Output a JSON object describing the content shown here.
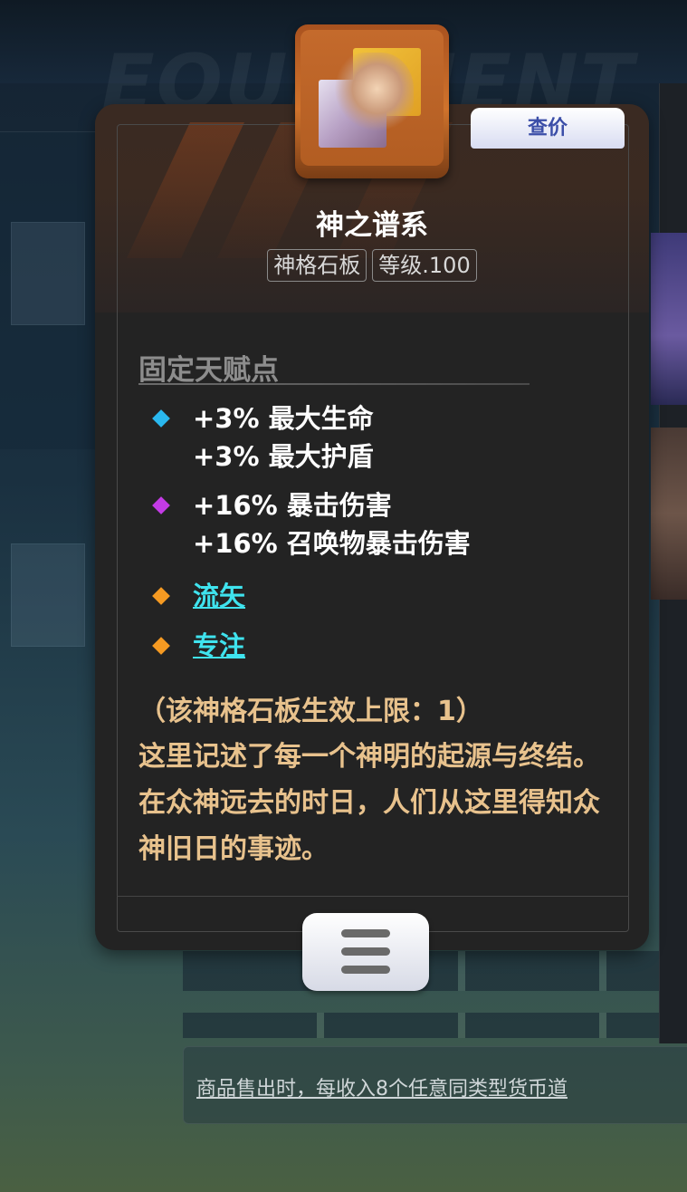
{
  "background": {
    "watermark": "EQUIPMENT",
    "footer_text": "商品售出时，每收入8个任意同类型货币道"
  },
  "tooltip": {
    "price_button": "查价",
    "item_name": "神之谱系",
    "tags": [
      "神格石板",
      "等级.100"
    ],
    "section_title": "固定天赋点",
    "affixes": [
      {
        "diamond_color": "#2ab8ef",
        "lines": [
          "+3% 最大生命",
          "+3% 最大护盾"
        ],
        "link": false
      },
      {
        "diamond_color": "#c43be6",
        "lines": [
          "+16% 暴击伤害",
          "+16% 召唤物暴击伤害"
        ],
        "link": false
      },
      {
        "diamond_color": "#f59a22",
        "lines": [
          "流矢"
        ],
        "link": true
      },
      {
        "diamond_color": "#f59a22",
        "lines": [
          "专注"
        ],
        "link": true
      }
    ],
    "limit_text": "（该神格石板生效上限：1）",
    "description": "这里记述了每一个神明的起源与终结。在众神远去的时日，人们从这里得知众神旧日的事迹。",
    "menu_icon": "menu-icon"
  },
  "colors": {
    "card_bg": "#232323",
    "desc_gold": "#e8c28d",
    "link_cyan": "#3fe3ee",
    "price_text": "#3b4ea8"
  }
}
